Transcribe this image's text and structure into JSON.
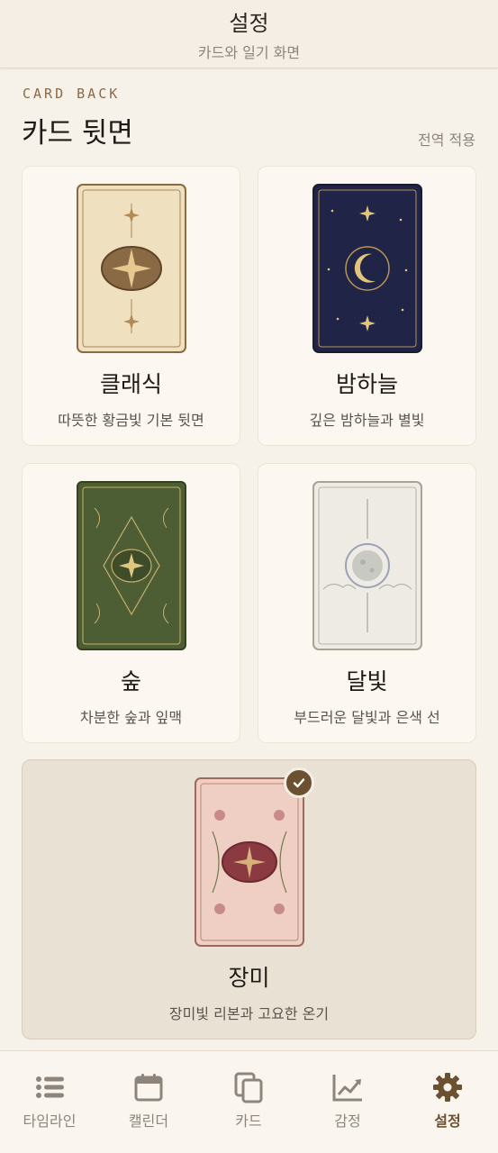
{
  "header": {
    "title": "설정",
    "subtitle": "카드와 일기 화면"
  },
  "section": {
    "eyebrow": "CARD BACK",
    "title": "카드 뒷면",
    "action": "전역 적용"
  },
  "cards": [
    {
      "name": "클래식",
      "desc": "따뜻한 황금빛 기본 뒷면",
      "selected": false
    },
    {
      "name": "밤하늘",
      "desc": "깊은 밤하늘과 별빛",
      "selected": false
    },
    {
      "name": "숲",
      "desc": "차분한 숲과 잎맥",
      "selected": false
    },
    {
      "name": "달빛",
      "desc": "부드러운 달빛과 은색 선",
      "selected": false
    },
    {
      "name": "장미",
      "desc": "장미빛 리본과 고요한 온기",
      "selected": true
    }
  ],
  "tabs": [
    {
      "label": "타임라인",
      "icon": "list-icon",
      "active": false
    },
    {
      "label": "캘린더",
      "icon": "calendar-icon",
      "active": false
    },
    {
      "label": "카드",
      "icon": "cards-icon",
      "active": false
    },
    {
      "label": "감정",
      "icon": "chart-line-icon",
      "active": false
    },
    {
      "label": "설정",
      "icon": "gear-icon",
      "active": true
    }
  ],
  "colors": {
    "accent": "#6c5130",
    "background": "#f6f1e9",
    "card": "#fcf7f1",
    "selected_card": "#e9e1d4",
    "muted_text": "#8d857b"
  }
}
